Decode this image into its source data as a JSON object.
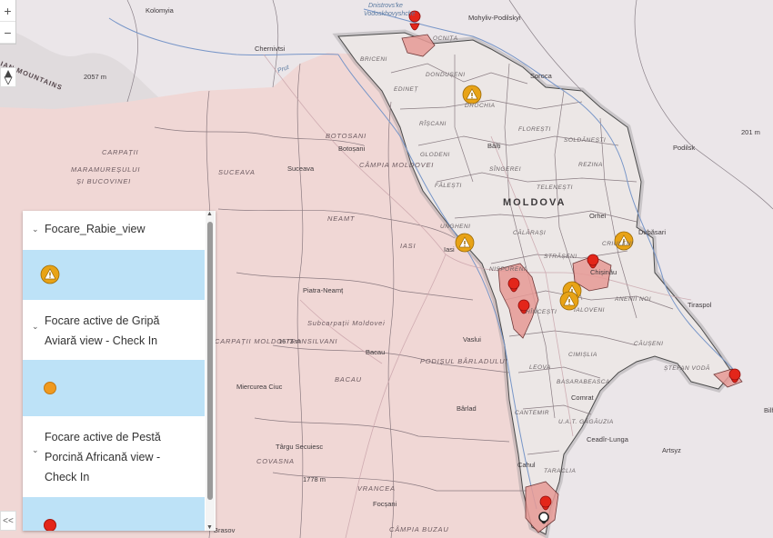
{
  "map": {
    "country": "MOLDOVA",
    "mountains": [
      "IAN MOUNTAINS"
    ],
    "water": [
      "Dnistrovs'ke",
      "Vodoskhovyshche",
      "Prut"
    ],
    "elevations": [
      "2057 m",
      "1673 m",
      "1778 m",
      "201 m"
    ],
    "regions": [
      "CARPAȚII MARAMUREȘULUI ȘI BUCOVINEI",
      "BOTOSANI",
      "SUCEAVA",
      "CÂMPIA MOLDOVEI",
      "IASI",
      "NEAMT",
      "PODIȘUL BÂRLADULUI",
      "Subcarpații Moldovei",
      "BACAU",
      "COVASNA",
      "VRANCEA",
      "CÂMPIA BUZAU",
      "CARPAȚII MOLDO-TRANSILVANI"
    ],
    "cities": [
      "Kolomyia",
      "Chernivtsi",
      "Mohyliv-Podilskyi",
      "Soroca",
      "Podilsk",
      "Botoșani",
      "Suceava",
      "Iasi",
      "Bălți",
      "Orhei",
      "Dubăsari",
      "Chișinău",
      "Tiraspol",
      "Piatra-Neamț",
      "Vaslui",
      "Bacau",
      "Miercurea Ciuc",
      "Bârlad",
      "Comrat",
      "Ceadîr-Lunga",
      "Cahul",
      "Artsyz",
      "Târgu Secuiesc",
      "Brasov",
      "Focșani",
      "Bilh"
    ],
    "districts": [
      "BRICENI",
      "OCNIȚA",
      "DONDUȘENI",
      "EDINEȚ",
      "DROCHIA",
      "RÎȘCANI",
      "FLOREȘTI",
      "SOLDĂNEȘTI",
      "GLODENI",
      "SÎNGEREI",
      "REZINA",
      "FĂLEȘTI",
      "TELENEȘTI",
      "UNGHENI",
      "CĂLĂRAȘI",
      "STRĂȘENI",
      "NISPORENI",
      "HÎNCEȘTI",
      "IALOVENI",
      "ANENII NOI",
      "CĂUȘENI",
      "CIMIȘLIA",
      "LEOVA",
      "ȘTEFAN VODĂ",
      "BASARABEASCA",
      "CANTEMIR",
      "TARACLIA",
      "U.A.T. GĂGĂUZIA",
      "CRIULENI"
    ]
  },
  "controls": {
    "zoom_in": "+",
    "zoom_out": "−",
    "collapse": "<<"
  },
  "legend": {
    "layers": [
      {
        "title": "Focare_Rabie_view",
        "symbol": "warning-triangle"
      },
      {
        "title": "Focare active de Gripă Aviară view - Check In",
        "symbol": "orange-dot"
      },
      {
        "title": "Focare active de Pestă Porcină Africană view - Check In",
        "symbol": "red-dot"
      }
    ]
  },
  "colors": {
    "romania_fill": "#f0d7d5",
    "moldova_fill": "#ece7e6",
    "outbreak_area": "#e79a96",
    "marker_red": "#e3261a",
    "marker_orange": "#e8a316",
    "legend_highlight": "#bde2f7"
  }
}
